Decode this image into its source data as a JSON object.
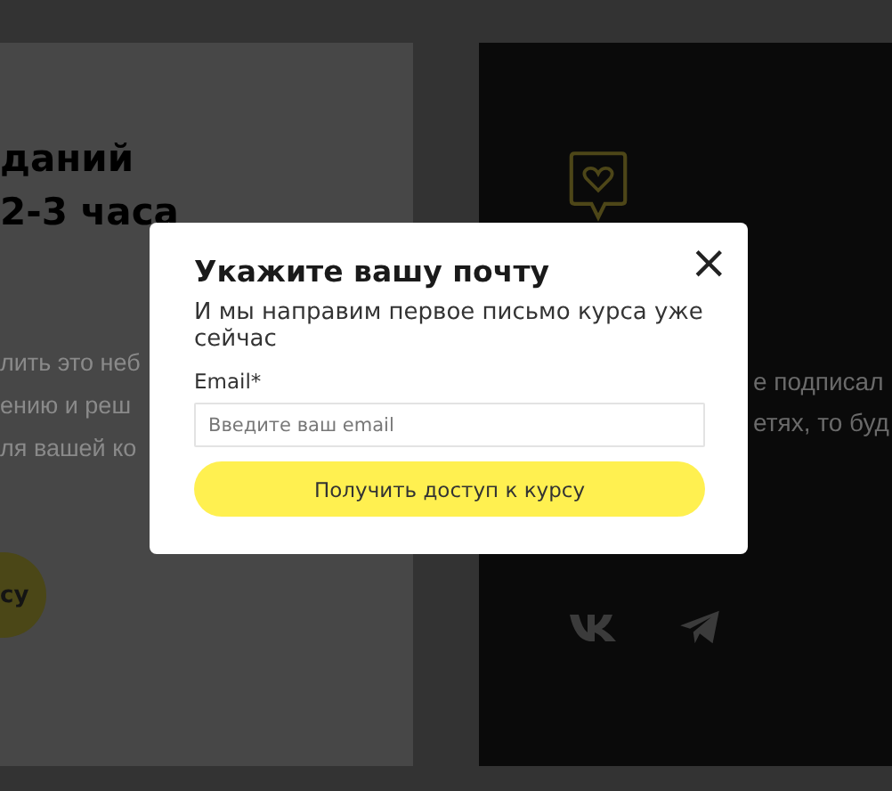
{
  "page": {
    "heading_lines": [
      "даний",
      "2-3 часа"
    ],
    "text_lines": [
      "лить это неб",
      "ению и реш",
      "ля вашей ко"
    ],
    "cta_button": "су",
    "panel_lines": [
      "е подписал",
      "етях, то буд"
    ]
  },
  "modal": {
    "title": "Укажите вашу почту",
    "subtitle": "И мы направим первое письмо курса уже сейчас",
    "close": "×",
    "email_label": "Email*",
    "email_placeholder": "Введите ваш email",
    "submit": "Получить доступ к курсу"
  }
}
